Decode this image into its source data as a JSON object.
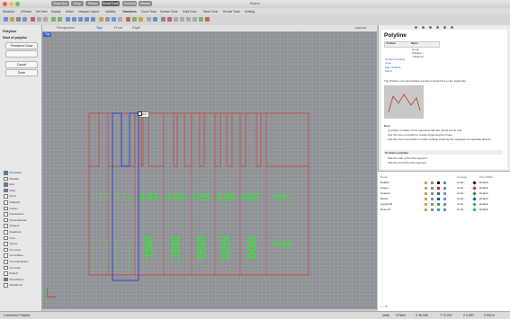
{
  "window": {
    "title": "Boxrer"
  },
  "file_tabs": [
    "Drop Box",
    "Scrip",
    "Planer",
    "SmartTrack",
    "Gumball",
    "History"
  ],
  "toolbar_tabs": [
    "Standard",
    "CPlanes",
    "Set View",
    "Display",
    "Select",
    "Viewport Layout",
    "Visibility",
    "Transform",
    "Curve Tools",
    "Surface Tools",
    "Solid Tools",
    "Mesh Tools",
    "Render Tools",
    "Drafting"
  ],
  "command_panel": {
    "title": "Polyline",
    "prompt": "Start of polyline",
    "buttons": [
      "Persistent Close",
      "Cancel",
      "Done"
    ]
  },
  "osnaps": [
    {
      "label": "Persistent",
      "on": true
    },
    {
      "label": "Disable",
      "on": false
    },
    {
      "label": "End",
      "on": true
    },
    {
      "label": "Near",
      "on": true
    },
    {
      "label": "Point",
      "on": false
    },
    {
      "label": "Midpoint",
      "on": false
    },
    {
      "label": "Center",
      "on": false
    },
    {
      "label": "Intersection",
      "on": false
    },
    {
      "label": "Perpendicular",
      "on": false
    },
    {
      "label": "Tangent",
      "on": false
    },
    {
      "label": "Quadrant",
      "on": false
    },
    {
      "label": "Knot",
      "on": false
    },
    {
      "label": "Vertex",
      "on": false
    },
    {
      "label": "On curve",
      "on": false
    },
    {
      "label": "On surface",
      "on": false
    },
    {
      "label": "On polysurface",
      "on": false
    },
    {
      "label": "On mesh",
      "on": false
    },
    {
      "label": "Project",
      "on": false
    },
    {
      "label": "SmartTrack",
      "on": true
    },
    {
      "label": "Disable all",
      "on": false
    }
  ],
  "viewport": {
    "tabs": [
      "Perspective",
      "Top",
      "Front",
      "Right"
    ],
    "active_tab": "Top",
    "label": "Top",
    "layouts": "Layouts",
    "snap_tooltip": "End",
    "row_numbers": [
      "4.15",
      "4.10",
      "4.05",
      "4.00",
      "3.95",
      "3.90",
      "3.85"
    ],
    "row_unit": "mm",
    "col_numbers": [
      "150",
      "100",
      "050",
      "025",
      "000"
    ],
    "col_unit": "%op"
  },
  "help": {
    "title": "Polyline",
    "col1": "Toolbar",
    "col2": "Menu",
    "menu_items": [
      "Curve",
      "Polyline >",
      "<Options>"
    ],
    "toolbar_items": [
      "Curves Creating Lines",
      "Main Sidebar Main1"
    ],
    "description": "The Polyline command draws a series of joined line or arc segments.",
    "notes_title": "Note",
    "notes": [
      "A polyline consists of line segments that are joined end to end.",
      "Use the Line command to create single-segment lines.",
      "Use the Lines command to create multiple touching line segments as separate objects."
    ],
    "steps_title": "To draw a polyline",
    "steps": [
      "Pick the start of the first segment.",
      "Pick the end of the first segment."
    ]
  },
  "layers": {
    "headers": [
      "Name",
      "Linetype",
      "Print Width"
    ],
    "rows": [
      {
        "name": "Default",
        "linetype": "Conti...",
        "width": "Default",
        "color": "#111111"
      },
      {
        "name": "Shape",
        "linetype": "Conti...",
        "width": "Default",
        "color": "#cc2222"
      },
      {
        "name": "Grapevi",
        "linetype": "Conti...",
        "width": "Default",
        "color": "#228844"
      },
      {
        "name": "Bezier",
        "linetype": "Conti...",
        "width": "Default",
        "color": "#2244cc"
      },
      {
        "name": "segment6",
        "linetype": "Conti...",
        "width": "Default",
        "color": "#33aa33"
      },
      {
        "name": "New set",
        "linetype": "Conti...",
        "width": "Default",
        "color": "#22aaaa"
      }
    ]
  },
  "status": {
    "command": "Command: Polyline",
    "units": "Units",
    "cplane": "CPlane",
    "x": "X 36.186",
    "y": "Y 72.242",
    "z": "Z 0.000",
    "scale": "0.001 in"
  },
  "colors": {
    "curve_red": "#d33a3a",
    "curve_blue": "#2a3fd1",
    "text_green": "#39e039",
    "grid": "#8e9296"
  }
}
